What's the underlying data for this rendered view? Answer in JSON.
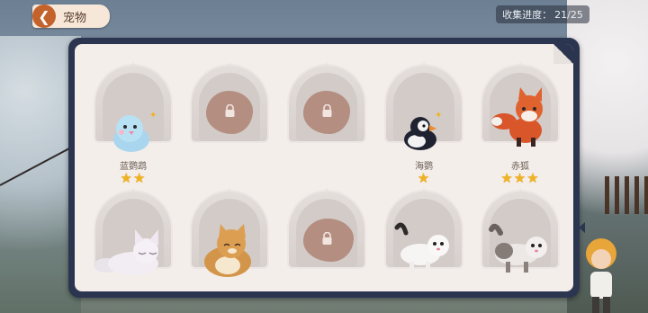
{
  "header": {
    "title": "宠物",
    "back_icon": "back-arrow-icon"
  },
  "progress": {
    "label": "收集进度：",
    "value": "21/25"
  },
  "pets": [
    {
      "name": "蓝鹦鹉",
      "stars": "★★",
      "locked": false,
      "icon": "blue-parrot-icon"
    },
    {
      "name": "",
      "stars": "",
      "locked": true,
      "icon": "lock-icon"
    },
    {
      "name": "",
      "stars": "",
      "locked": true,
      "icon": "lock-icon"
    },
    {
      "name": "海鹦",
      "stars": "★",
      "locked": false,
      "icon": "puffin-icon"
    },
    {
      "name": "赤狐",
      "stars": "★★★",
      "locked": false,
      "icon": "red-fox-icon"
    },
    {
      "name": "",
      "stars": "",
      "locked": false,
      "icon": "arctic-fox-icon"
    },
    {
      "name": "",
      "stars": "",
      "locked": false,
      "icon": "orange-cat-icon"
    },
    {
      "name": "",
      "stars": "",
      "locked": true,
      "icon": "lock-icon"
    },
    {
      "name": "",
      "stars": "",
      "locked": false,
      "icon": "white-ferret-icon"
    },
    {
      "name": "",
      "stars": "",
      "locked": false,
      "icon": "gray-ferret-icon"
    }
  ],
  "colors": {
    "panel_border": "#2c3550",
    "panel_bg": "#f4eeea",
    "star": "#f1b21f",
    "locked": "#b48e80"
  }
}
